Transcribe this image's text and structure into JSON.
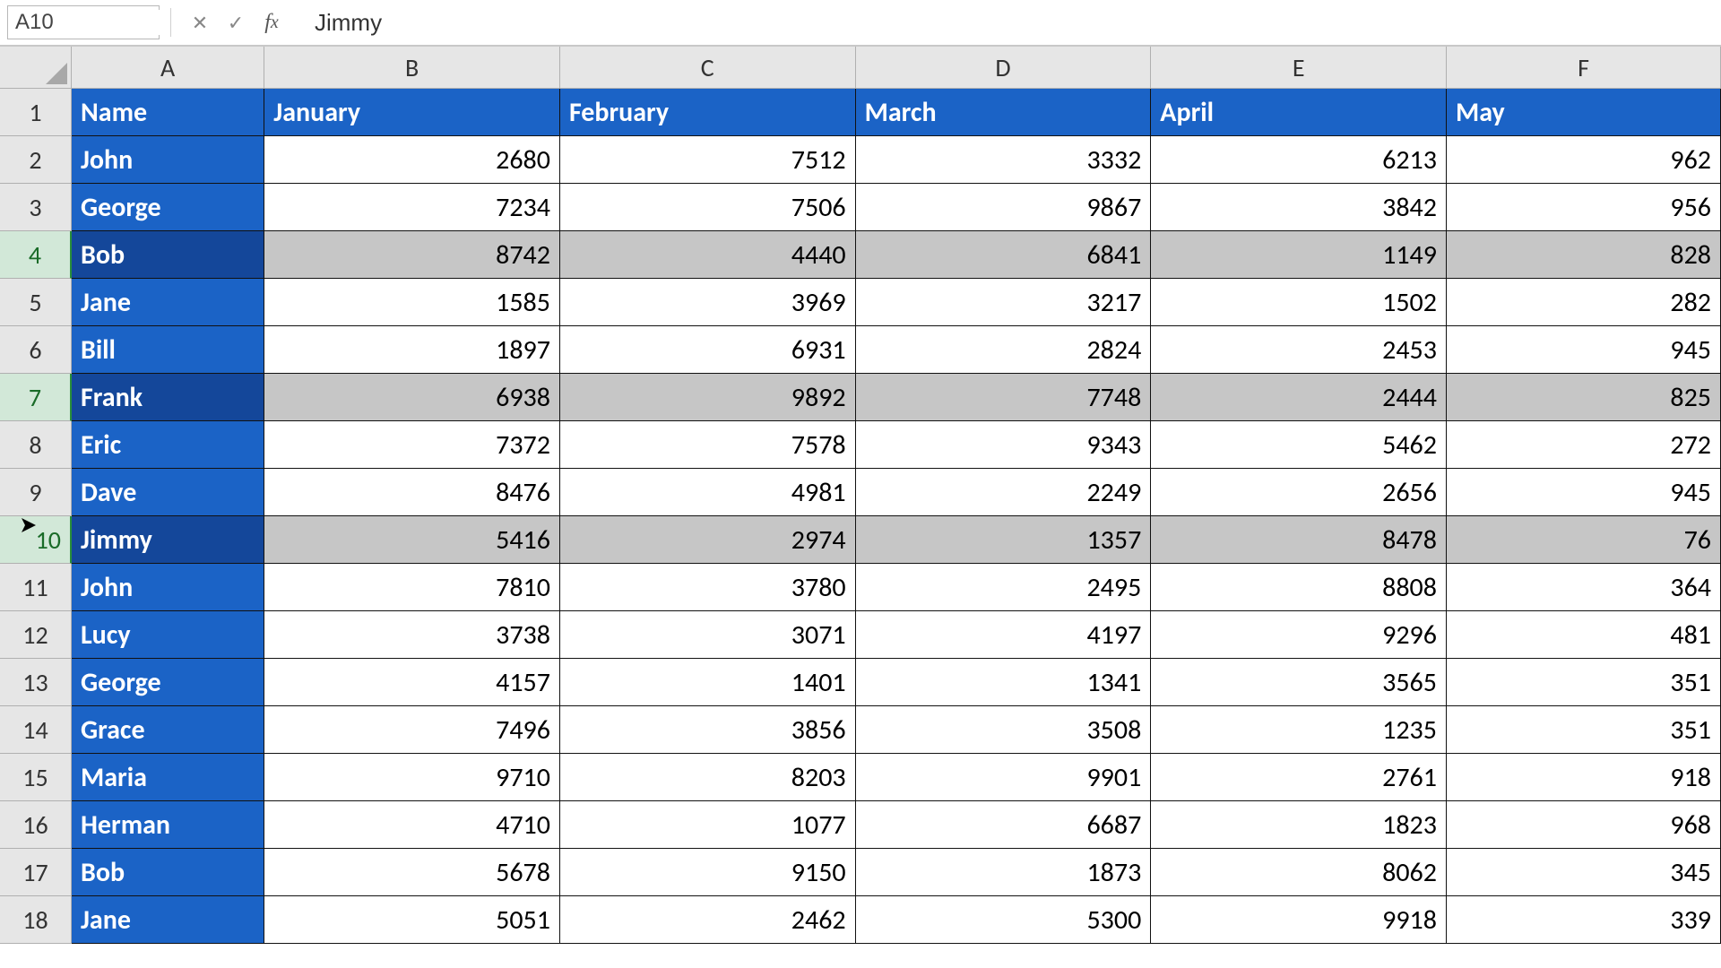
{
  "formula_bar": {
    "name_box": "A10",
    "formula_value": "Jimmy"
  },
  "columns": [
    "A",
    "B",
    "C",
    "D",
    "E",
    "F"
  ],
  "header_row": [
    "Name",
    "January",
    "February",
    "March",
    "April",
    "May"
  ],
  "row_numbers": [
    1,
    2,
    3,
    4,
    5,
    6,
    7,
    8,
    9,
    10,
    11,
    12,
    13,
    14,
    15,
    16,
    17,
    18
  ],
  "selected_rows": [
    4,
    7,
    10
  ],
  "active_row": 10,
  "data_rows": [
    {
      "name": "John",
      "vals": [
        "2680",
        "7512",
        "3332",
        "6213",
        "962"
      ]
    },
    {
      "name": "George",
      "vals": [
        "7234",
        "7506",
        "9867",
        "3842",
        "956"
      ]
    },
    {
      "name": "Bob",
      "vals": [
        "8742",
        "4440",
        "6841",
        "1149",
        "828"
      ]
    },
    {
      "name": "Jane",
      "vals": [
        "1585",
        "3969",
        "3217",
        "1502",
        "282"
      ]
    },
    {
      "name": "Bill",
      "vals": [
        "1897",
        "6931",
        "2824",
        "2453",
        "945"
      ]
    },
    {
      "name": "Frank",
      "vals": [
        "6938",
        "9892",
        "7748",
        "2444",
        "825"
      ]
    },
    {
      "name": "Eric",
      "vals": [
        "7372",
        "7578",
        "9343",
        "5462",
        "272"
      ]
    },
    {
      "name": "Dave",
      "vals": [
        "8476",
        "4981",
        "2249",
        "2656",
        "945"
      ]
    },
    {
      "name": "Jimmy",
      "vals": [
        "5416",
        "2974",
        "1357",
        "8478",
        "76"
      ]
    },
    {
      "name": "John",
      "vals": [
        "7810",
        "3780",
        "2495",
        "8808",
        "364"
      ]
    },
    {
      "name": "Lucy",
      "vals": [
        "3738",
        "3071",
        "4197",
        "9296",
        "481"
      ]
    },
    {
      "name": "George",
      "vals": [
        "4157",
        "1401",
        "1341",
        "3565",
        "351"
      ]
    },
    {
      "name": "Grace",
      "vals": [
        "7496",
        "3856",
        "3508",
        "1235",
        "351"
      ]
    },
    {
      "name": "Maria",
      "vals": [
        "9710",
        "8203",
        "9901",
        "2761",
        "918"
      ]
    },
    {
      "name": "Herman",
      "vals": [
        "4710",
        "1077",
        "6687",
        "1823",
        "968"
      ]
    },
    {
      "name": "Bob",
      "vals": [
        "5678",
        "9150",
        "1873",
        "8062",
        "345"
      ]
    },
    {
      "name": "Jane",
      "vals": [
        "5051",
        "2462",
        "5300",
        "9918",
        "339"
      ]
    }
  ],
  "chart_data": {
    "type": "table",
    "columns": [
      "Name",
      "January",
      "February",
      "March",
      "April",
      "May"
    ],
    "rows": [
      [
        "John",
        2680,
        7512,
        3332,
        6213,
        962
      ],
      [
        "George",
        7234,
        7506,
        9867,
        3842,
        956
      ],
      [
        "Bob",
        8742,
        4440,
        6841,
        1149,
        828
      ],
      [
        "Jane",
        1585,
        3969,
        3217,
        1502,
        282
      ],
      [
        "Bill",
        1897,
        6931,
        2824,
        2453,
        945
      ],
      [
        "Frank",
        6938,
        9892,
        7748,
        2444,
        825
      ],
      [
        "Eric",
        7372,
        7578,
        9343,
        5462,
        272
      ],
      [
        "Dave",
        8476,
        4981,
        2249,
        2656,
        945
      ],
      [
        "Jimmy",
        5416,
        2974,
        1357,
        8478,
        76
      ],
      [
        "John",
        7810,
        3780,
        2495,
        8808,
        364
      ],
      [
        "Lucy",
        3738,
        3071,
        4197,
        9296,
        481
      ],
      [
        "George",
        4157,
        1401,
        1341,
        3565,
        351
      ],
      [
        "Grace",
        7496,
        3856,
        3508,
        1235,
        351
      ],
      [
        "Maria",
        9710,
        8203,
        9901,
        2761,
        918
      ],
      [
        "Herman",
        4710,
        1077,
        6687,
        1823,
        968
      ],
      [
        "Bob",
        5678,
        9150,
        1873,
        8062,
        345
      ],
      [
        "Jane",
        5051,
        2462,
        5300,
        9918,
        339
      ]
    ]
  }
}
